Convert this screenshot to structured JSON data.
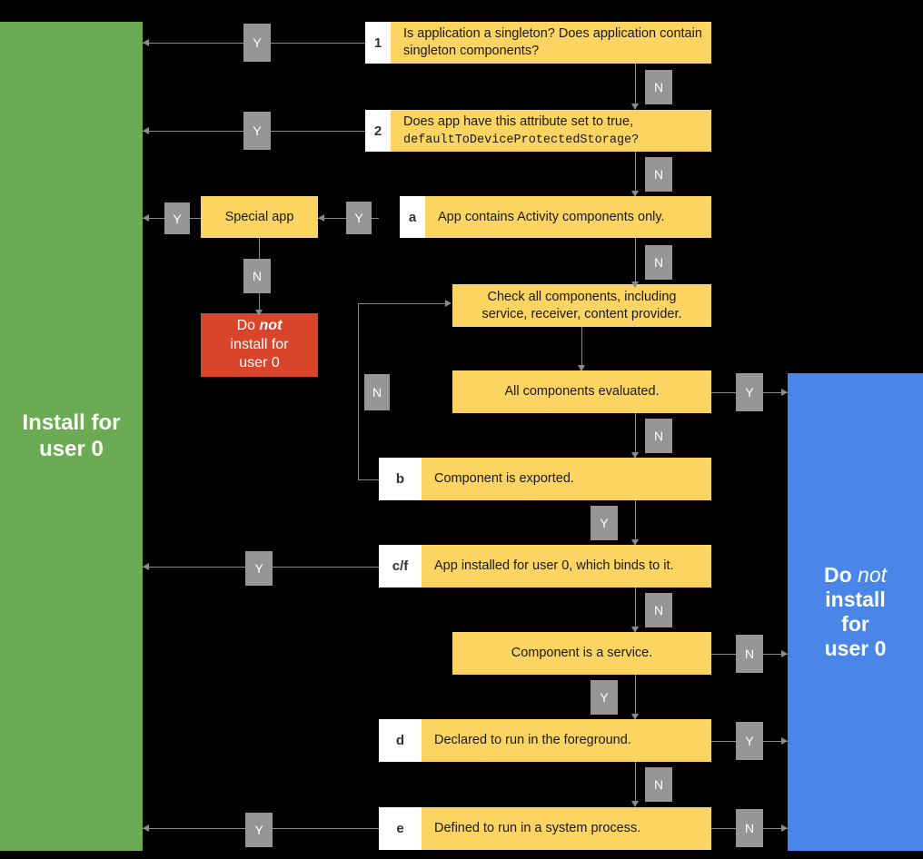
{
  "diagram": {
    "title": "Android user 0 app installation decision flow",
    "colors": {
      "process": "#FCD462",
      "install": "#6BAB54",
      "do_not_install": "#4A86E8",
      "do_not_install_alt": "#D8452A",
      "edge_label": "#969696",
      "connector": "#8a8a8a",
      "background": "#000000"
    }
  },
  "terminals": {
    "install": {
      "line1": "Install for",
      "line2": "user 0"
    },
    "do_not_install_blue": {
      "line1_pre": "Do ",
      "line1_em": "not",
      "line2": "install",
      "line3": "for",
      "line4": "user 0"
    },
    "do_not_install_red": {
      "line1_pre": "Do ",
      "line1_em": "not",
      "line2": "install for",
      "line3": "user 0"
    }
  },
  "nodes": [
    {
      "id": "n1",
      "tag": "1",
      "text": "Is application a singleton? Does application contain singleton components?"
    },
    {
      "id": "n2",
      "tag": "2",
      "text_line1": "Does app have this attribute set to true,",
      "text_mono": "defaultToDeviceProtectedStorage?"
    },
    {
      "id": "special",
      "tag": "",
      "text": "Special app"
    },
    {
      "id": "na",
      "tag": "a",
      "text": "App contains Activity components only."
    },
    {
      "id": "check",
      "tag": "",
      "text_line1": "Check all components, including",
      "text_line2": "service, receiver, content provider."
    },
    {
      "id": "evaluated",
      "tag": "",
      "text": "All components evaluated."
    },
    {
      "id": "nb",
      "tag": "b",
      "text": "Component is exported."
    },
    {
      "id": "ncf",
      "tag": "c/f",
      "text": "App installed for user 0, which binds to it."
    },
    {
      "id": "service",
      "tag": "",
      "text": "Component is a service."
    },
    {
      "id": "nd",
      "tag": "d",
      "text": "Declared to run in the foreground."
    },
    {
      "id": "ne",
      "tag": "e",
      "text": "Defined to run in a system process."
    }
  ],
  "edge_labels": {
    "n1_yes": "Y",
    "n1_no": "N",
    "n2_yes": "Y",
    "n2_no": "N",
    "special_yes": "Y",
    "special_no": "N",
    "na_yes": "Y",
    "na_no": "N",
    "loop_no": "N",
    "evaluated_yes": "Y",
    "evaluated_no": "N",
    "nb_yes": "Y",
    "ncf_yes": "Y",
    "ncf_no": "N",
    "service_no": "N",
    "service_yes": "Y",
    "nd_yes": "Y",
    "nd_no": "N",
    "ne_yes": "Y",
    "ne_no": "N"
  }
}
